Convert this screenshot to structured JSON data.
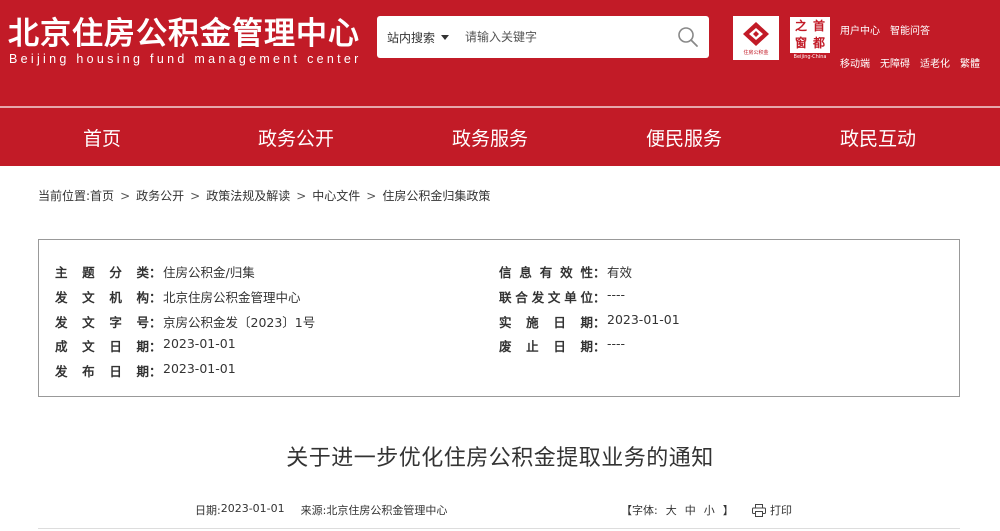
{
  "header": {
    "title": "北京住房公积金管理中心",
    "subtitle": "Beijing housing fund management center",
    "search": {
      "scope": "站内搜索",
      "placeholder": "请输入关键字"
    },
    "logo1_caption": "住房公积金",
    "logo2_glyphs": [
      "之",
      "首",
      "窗",
      "都"
    ],
    "logo2_caption": "Beijing·China",
    "links_row1": [
      "用户中心",
      "智能问答"
    ],
    "links_row2": [
      "移动端",
      "无障碍",
      "适老化",
      "繁體"
    ]
  },
  "nav": {
    "items": [
      "首页",
      "政务公开",
      "政务服务",
      "便民服务",
      "政民互动"
    ]
  },
  "breadcrumb": {
    "label": "当前位置:",
    "items": [
      "首页",
      "政务公开",
      "政策法规及解读",
      "中心文件",
      "住房公积金归集政策"
    ],
    "separator": ">"
  },
  "meta": {
    "left": [
      {
        "label": "主题分类",
        "value": "住房公积金/归集"
      },
      {
        "label": "发文机构",
        "value": "北京住房公积金管理中心"
      },
      {
        "label": "发文字号",
        "value": "京房公积金发〔2023〕1号"
      },
      {
        "label": "成文日期",
        "value": "2023-01-01"
      },
      {
        "label": "发布日期",
        "value": "2023-01-01"
      }
    ],
    "right": [
      {
        "label": "信息有效性",
        "value": "有效"
      },
      {
        "label": "联合发文单位",
        "value": "----"
      },
      {
        "label": "实施日期",
        "value": "2023-01-01"
      },
      {
        "label": "废止日期",
        "value": "----"
      }
    ]
  },
  "document": {
    "title": "关于进一步优化住房公积金提取业务的通知",
    "date_label": "日期:",
    "date": "2023-01-01",
    "source_label": "来源:",
    "source": "北京住房公积金管理中心",
    "font_label": "【字体:",
    "font_large": "大",
    "font_medium": "中",
    "font_small": "小",
    "font_close": "】",
    "print": "打印"
  },
  "colors": {
    "brand_red": "#c21b27"
  }
}
